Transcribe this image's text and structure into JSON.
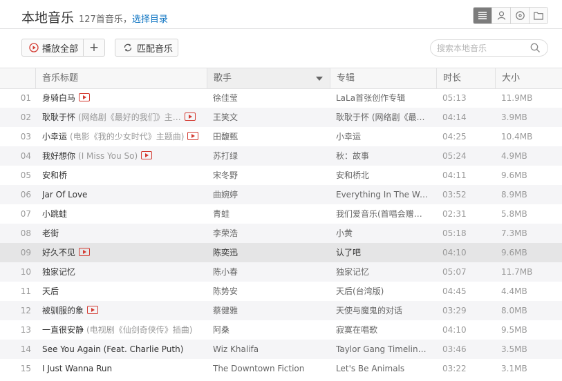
{
  "header": {
    "title": "本地音乐",
    "count_text": "127首音乐，",
    "choose_dir": "选择目录"
  },
  "view_buttons": [
    {
      "icon": "list-icon"
    },
    {
      "icon": "artist-icon"
    },
    {
      "icon": "album-icon"
    },
    {
      "icon": "folder-icon"
    }
  ],
  "toolbar": {
    "play_all": "播放全部",
    "add": "+",
    "match": "匹配音乐",
    "search_placeholder": "搜索本地音乐",
    "search_value": ""
  },
  "columns": {
    "title": "音乐标题",
    "artist": "歌手",
    "album": "专辑",
    "duration": "时长",
    "size": "大小"
  },
  "accent_color": "#d33a31",
  "songs": [
    {
      "idx": "01",
      "title": "身骑白马",
      "alias": "",
      "mv": true,
      "artist": "徐佳莹",
      "album": "LaLa首张创作专辑",
      "duration": "05:13",
      "size": "11.9MB"
    },
    {
      "idx": "02",
      "title": "耿耿于怀",
      "alias": "(网络剧《最好的我们》主…",
      "mv": true,
      "artist": "王笑文",
      "album": "耿耿于怀 (网络剧《最好…",
      "duration": "04:14",
      "size": "3.9MB"
    },
    {
      "idx": "03",
      "title": "小幸运",
      "alias": "(电影《我的少女时代》主题曲)",
      "mv": true,
      "artist": "田馥甄",
      "album": "小幸运",
      "duration": "04:25",
      "size": "10.4MB"
    },
    {
      "idx": "04",
      "title": "我好想你",
      "alias": "(I Miss You So)",
      "mv": true,
      "artist": "苏打绿",
      "album": "秋：故事",
      "duration": "05:24",
      "size": "4.9MB"
    },
    {
      "idx": "05",
      "title": "安和桥",
      "alias": "",
      "mv": false,
      "artist": "宋冬野",
      "album": "安和桥北",
      "duration": "04:11",
      "size": "9.6MB"
    },
    {
      "idx": "06",
      "title": "Jar Of Love",
      "alias": "",
      "mv": false,
      "artist": "曲婉婷",
      "album": "Everything In The Worl…",
      "duration": "03:52",
      "size": "8.9MB"
    },
    {
      "idx": "07",
      "title": "小跳蛙",
      "alias": "",
      "mv": false,
      "artist": "青蛙",
      "album": "我们爱音乐(首唱会赠送…",
      "duration": "02:31",
      "size": "5.8MB"
    },
    {
      "idx": "08",
      "title": "老街",
      "alias": "",
      "mv": false,
      "artist": "李荣浩",
      "album": "小黄",
      "duration": "05:18",
      "size": "7.3MB"
    },
    {
      "idx": "09",
      "title": "好久不见",
      "alias": "",
      "mv": true,
      "artist": "陈奕迅",
      "album": "认了吧",
      "duration": "04:10",
      "size": "9.6MB",
      "selected": true
    },
    {
      "idx": "10",
      "title": "独家记忆",
      "alias": "",
      "mv": false,
      "artist": "陈小春",
      "album": "独家记忆",
      "duration": "05:07",
      "size": "11.7MB"
    },
    {
      "idx": "11",
      "title": "天后",
      "alias": "",
      "mv": false,
      "artist": "陈势安",
      "album": "天后(台湾版)",
      "duration": "04:45",
      "size": "4.4MB"
    },
    {
      "idx": "12",
      "title": "被驯服的象",
      "alias": "",
      "mv": true,
      "artist": "蔡健雅",
      "album": "天使与魔鬼的对话",
      "duration": "03:29",
      "size": "8.0MB"
    },
    {
      "idx": "13",
      "title": "一直很安静",
      "alias": "(电视剧《仙剑奇侠传》插曲)",
      "mv": false,
      "artist": "阿桑",
      "album": "寂寞在唱歌",
      "duration": "04:10",
      "size": "9.5MB"
    },
    {
      "idx": "14",
      "title": "See You Again (Feat. Charlie Puth)",
      "alias": "",
      "mv": false,
      "artist": "Wiz Khalifa",
      "album": "Taylor Gang Timeline (…",
      "duration": "03:46",
      "size": "3.5MB"
    },
    {
      "idx": "15",
      "title": "I Just Wanna Run",
      "alias": "",
      "mv": false,
      "artist": "The Downtown Fiction",
      "album": "Let's Be Animals",
      "duration": "03:22",
      "size": "3.1MB"
    }
  ]
}
